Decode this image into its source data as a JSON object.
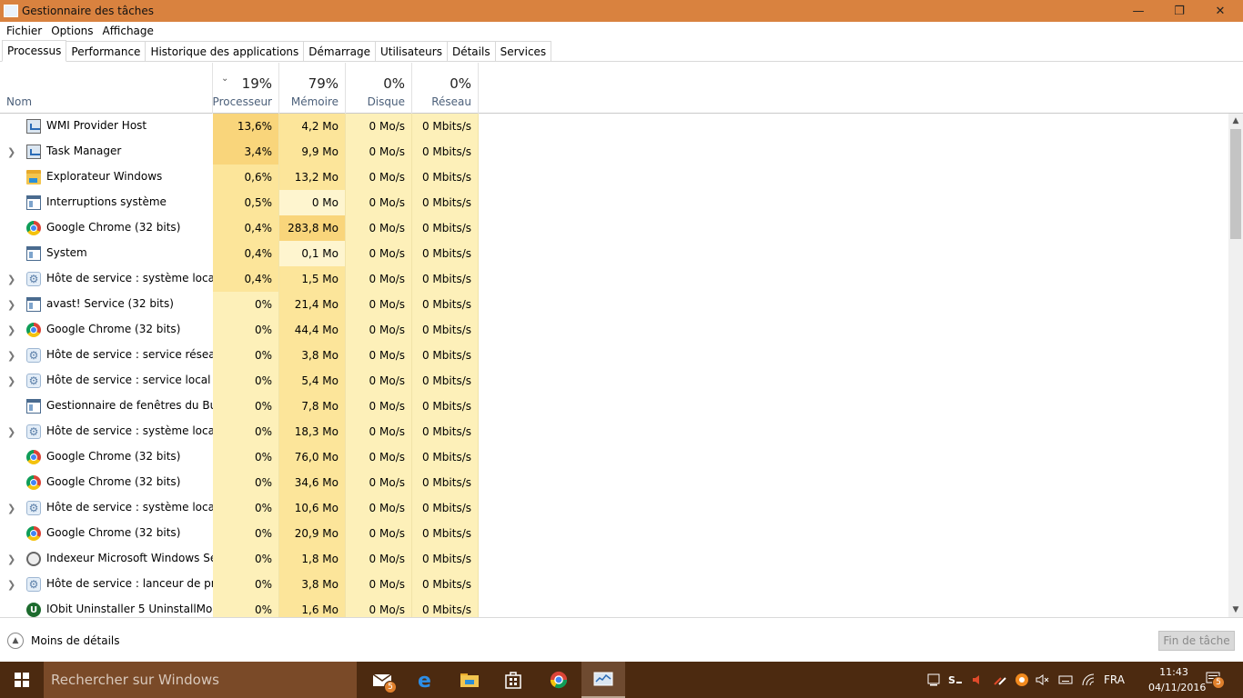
{
  "window": {
    "title": "Gestionnaire des tâches",
    "minimize_glyph": "—",
    "maximize_glyph": "❐",
    "close_glyph": "✕"
  },
  "menu": [
    "Fichier",
    "Options",
    "Affichage"
  ],
  "tabs": [
    "Processus",
    "Performance",
    "Historique des applications",
    "Démarrage",
    "Utilisateurs",
    "Détails",
    "Services"
  ],
  "active_tab": "Processus",
  "columns": {
    "name": {
      "label": "Nom"
    },
    "cpu": {
      "label": "Processeur",
      "percent": "19%"
    },
    "memory": {
      "label": "Mémoire",
      "percent": "79%"
    },
    "disk": {
      "label": "Disque",
      "percent": "0%"
    },
    "network": {
      "label": "Réseau",
      "percent": "0%"
    }
  },
  "processes": [
    {
      "name": "WMI Provider Host",
      "cpu": "13,6%",
      "mem": "4,2 Mo",
      "disk": "0 Mo/s",
      "net": "0 Mbits/s",
      "expandable": false,
      "icon": "wmi-icon"
    },
    {
      "name": "Task Manager",
      "cpu": "3,4%",
      "mem": "9,9 Mo",
      "disk": "0 Mo/s",
      "net": "0 Mbits/s",
      "expandable": true,
      "icon": "task-manager-icon"
    },
    {
      "name": "Explorateur Windows",
      "cpu": "0,6%",
      "mem": "13,2 Mo",
      "disk": "0 Mo/s",
      "net": "0 Mbits/s",
      "expandable": false,
      "icon": "folder-icon"
    },
    {
      "name": "Interruptions système",
      "cpu": "0,5%",
      "mem": "0 Mo",
      "disk": "0 Mo/s",
      "net": "0 Mbits/s",
      "expandable": false,
      "icon": "window-icon"
    },
    {
      "name": "Google Chrome (32 bits)",
      "cpu": "0,4%",
      "mem": "283,8 Mo",
      "disk": "0 Mo/s",
      "net": "0 Mbits/s",
      "expandable": false,
      "icon": "chrome-icon"
    },
    {
      "name": "System",
      "cpu": "0,4%",
      "mem": "0,1 Mo",
      "disk": "0 Mo/s",
      "net": "0 Mbits/s",
      "expandable": false,
      "icon": "window-icon"
    },
    {
      "name": "Hôte de service : système local (...",
      "cpu": "0,4%",
      "mem": "1,5 Mo",
      "disk": "0 Mo/s",
      "net": "0 Mbits/s",
      "expandable": true,
      "icon": "gear-icon"
    },
    {
      "name": "avast! Service (32 bits)",
      "cpu": "0%",
      "mem": "21,4 Mo",
      "disk": "0 Mo/s",
      "net": "0 Mbits/s",
      "expandable": true,
      "icon": "window-icon"
    },
    {
      "name": "Google Chrome (32 bits)",
      "cpu": "0%",
      "mem": "44,4 Mo",
      "disk": "0 Mo/s",
      "net": "0 Mbits/s",
      "expandable": true,
      "icon": "chrome-icon"
    },
    {
      "name": "Hôte de service : service réseau ...",
      "cpu": "0%",
      "mem": "3,8 Mo",
      "disk": "0 Mo/s",
      "net": "0 Mbits/s",
      "expandable": true,
      "icon": "gear-icon"
    },
    {
      "name": "Hôte de service : service local (a...",
      "cpu": "0%",
      "mem": "5,4 Mo",
      "disk": "0 Mo/s",
      "net": "0 Mbits/s",
      "expandable": true,
      "icon": "gear-icon"
    },
    {
      "name": "Gestionnaire de fenêtres du Bur...",
      "cpu": "0%",
      "mem": "7,8 Mo",
      "disk": "0 Mo/s",
      "net": "0 Mbits/s",
      "expandable": false,
      "icon": "window-icon"
    },
    {
      "name": "Hôte de service : système local (...",
      "cpu": "0%",
      "mem": "18,3 Mo",
      "disk": "0 Mo/s",
      "net": "0 Mbits/s",
      "expandable": true,
      "icon": "gear-icon"
    },
    {
      "name": "Google Chrome (32 bits)",
      "cpu": "0%",
      "mem": "76,0 Mo",
      "disk": "0 Mo/s",
      "net": "0 Mbits/s",
      "expandable": false,
      "icon": "chrome-icon"
    },
    {
      "name": "Google Chrome (32 bits)",
      "cpu": "0%",
      "mem": "34,6 Mo",
      "disk": "0 Mo/s",
      "net": "0 Mbits/s",
      "expandable": false,
      "icon": "chrome-icon"
    },
    {
      "name": "Hôte de service : système local (...",
      "cpu": "0%",
      "mem": "10,6 Mo",
      "disk": "0 Mo/s",
      "net": "0 Mbits/s",
      "expandable": true,
      "icon": "gear-icon"
    },
    {
      "name": "Google Chrome (32 bits)",
      "cpu": "0%",
      "mem": "20,9 Mo",
      "disk": "0 Mo/s",
      "net": "0 Mbits/s",
      "expandable": false,
      "icon": "chrome-icon"
    },
    {
      "name": "Indexeur Microsoft Windows Se...",
      "cpu": "0%",
      "mem": "1,8 Mo",
      "disk": "0 Mo/s",
      "net": "0 Mbits/s",
      "expandable": true,
      "icon": "indexer-icon"
    },
    {
      "name": "Hôte de service : lanceur de pro...",
      "cpu": "0%",
      "mem": "3,8 Mo",
      "disk": "0 Mo/s",
      "net": "0 Mbits/s",
      "expandable": true,
      "icon": "gear-icon"
    },
    {
      "name": "IObit Uninstaller 5 UninstallMon...",
      "cpu": "0%",
      "mem": "1,6 Mo",
      "disk": "0 Mo/s",
      "net": "0 Mbits/s",
      "expandable": false,
      "icon": "iobit-icon"
    }
  ],
  "heat_colors": {
    "high": "#f9d57b",
    "medium": "#fce59a",
    "low": "#fdf0b9",
    "lowest": "#fef5cf"
  },
  "footer": {
    "less_details": "Moins de détails",
    "end_task": "Fin de tâche"
  },
  "taskbar": {
    "search_placeholder": "Rechercher sur Windows",
    "mail_badge": "5",
    "language": "FRA",
    "time": "11:43",
    "date": "04/11/2016",
    "notification_badge": "5",
    "accent": "#4c2a10"
  }
}
